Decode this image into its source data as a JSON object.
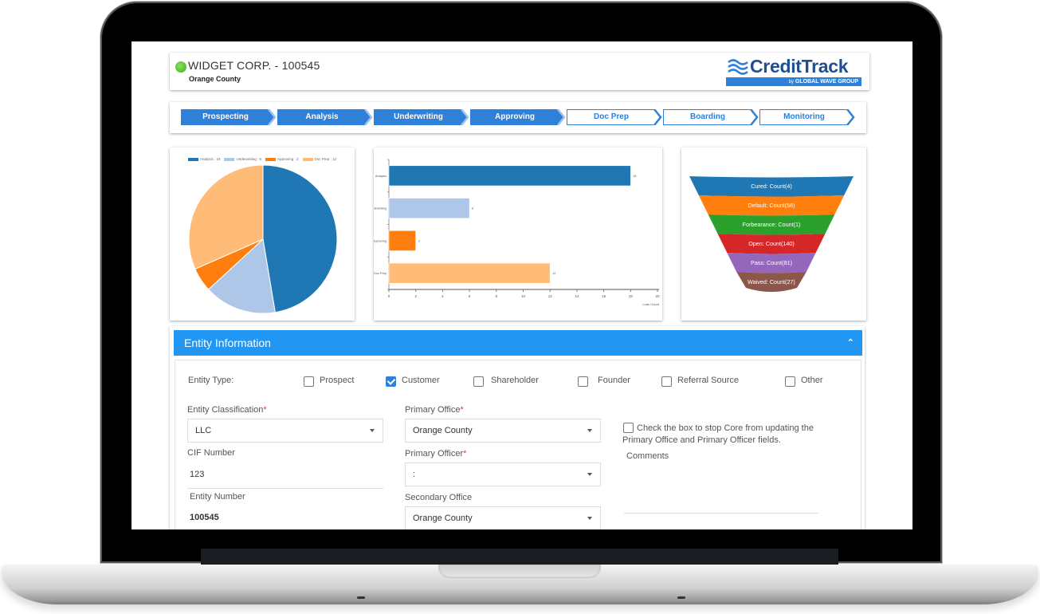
{
  "header": {
    "company": "WIDGET CORP. - 100545",
    "location": "Orange County",
    "status_color": "#4cc22a"
  },
  "logo": {
    "name": "CreditTrack",
    "by": "by",
    "group": "GLOBAL WAVE GROUP",
    "brand_color": "#1f4f8f",
    "bar_color": "#2f80d8"
  },
  "stages": [
    {
      "label": "Prospecting",
      "state": "done"
    },
    {
      "label": "Analysis",
      "state": "done"
    },
    {
      "label": "Underwriting",
      "state": "done"
    },
    {
      "label": "Approving",
      "state": "done"
    },
    {
      "label": "Doc Prep",
      "state": "todo"
    },
    {
      "label": "Boarding",
      "state": "todo"
    },
    {
      "label": "Monitoring",
      "state": "todo"
    }
  ],
  "chart_data": [
    {
      "type": "pie",
      "title": "",
      "legend_position": "top",
      "categories": [
        "Analysis",
        "Underwriting",
        "Approving",
        "Doc Prep"
      ],
      "values": [
        18,
        6,
        2,
        12
      ],
      "legend_labels": [
        "Analysis : 18",
        "Underwriting : 6",
        "Approving : 2",
        "Doc Prep : 12"
      ],
      "colors": [
        "#1f77b4",
        "#aec7e8",
        "#ff7f0e",
        "#ffbb78"
      ]
    },
    {
      "type": "bar",
      "orientation": "horizontal",
      "title": "",
      "categories": [
        "Analysis",
        "Underwriting",
        "Approving",
        "Doc Prep"
      ],
      "values": [
        18,
        6,
        2,
        12
      ],
      "data_labels": [
        "18",
        "6",
        "2",
        "12"
      ],
      "xlabel": "Loan Count",
      "ylabel": "",
      "xlim": [
        0,
        20
      ],
      "xticks": [
        "0",
        "2",
        "4",
        "6",
        "8",
        "10",
        "12",
        "14",
        "16",
        "18",
        "20"
      ],
      "colors": [
        "#1f77b4",
        "#aec7e8",
        "#ff7f0e",
        "#ffbb78"
      ]
    },
    {
      "type": "funnel",
      "title": "",
      "categories": [
        "Cured",
        "Default",
        "Forbearance",
        "Open",
        "Pass",
        "Waived"
      ],
      "values": [
        4,
        58,
        1,
        140,
        81,
        27
      ],
      "labels": [
        "Cured: Count(4)",
        "Default: Count(58)",
        "Forbearance: Count(1)",
        "Open: Count(140)",
        "Pass: Count(81)",
        "Waived: Count(27)"
      ],
      "colors": [
        "#1f77b4",
        "#ff7f0e",
        "#2ca02c",
        "#d62728",
        "#9467bd",
        "#8c564b"
      ]
    }
  ],
  "entity": {
    "section_title": "Entity Information",
    "collapse_icon": "chevron-up-icon",
    "type_label": "Entity Type:",
    "types": [
      {
        "label": "Prospect",
        "checked": false
      },
      {
        "label": "Customer",
        "checked": true
      },
      {
        "label": "Shareholder",
        "checked": false
      },
      {
        "label": "Founder",
        "checked": false
      },
      {
        "label": "Referral Source",
        "checked": false
      },
      {
        "label": "Other",
        "checked": false
      }
    ],
    "classification": {
      "label": "Entity Classification",
      "required": "*",
      "value": "LLC"
    },
    "cif": {
      "label": "CIF Number",
      "value": "123"
    },
    "entity_number": {
      "label": "Entity Number",
      "value": "100545"
    },
    "primary_office": {
      "label": "Primary Office",
      "required": "*",
      "value": "Orange County"
    },
    "primary_officer": {
      "label": "Primary Officer",
      "required": "*",
      "value": ":"
    },
    "secondary_office": {
      "label": "Secondary Office",
      "value": "Orange County"
    },
    "core_lock": {
      "label": "Check the box to stop Core from updating the Primary Office and Primary Officer fields.",
      "checked": false
    },
    "comments": {
      "label": "Comments",
      "value": ""
    }
  }
}
